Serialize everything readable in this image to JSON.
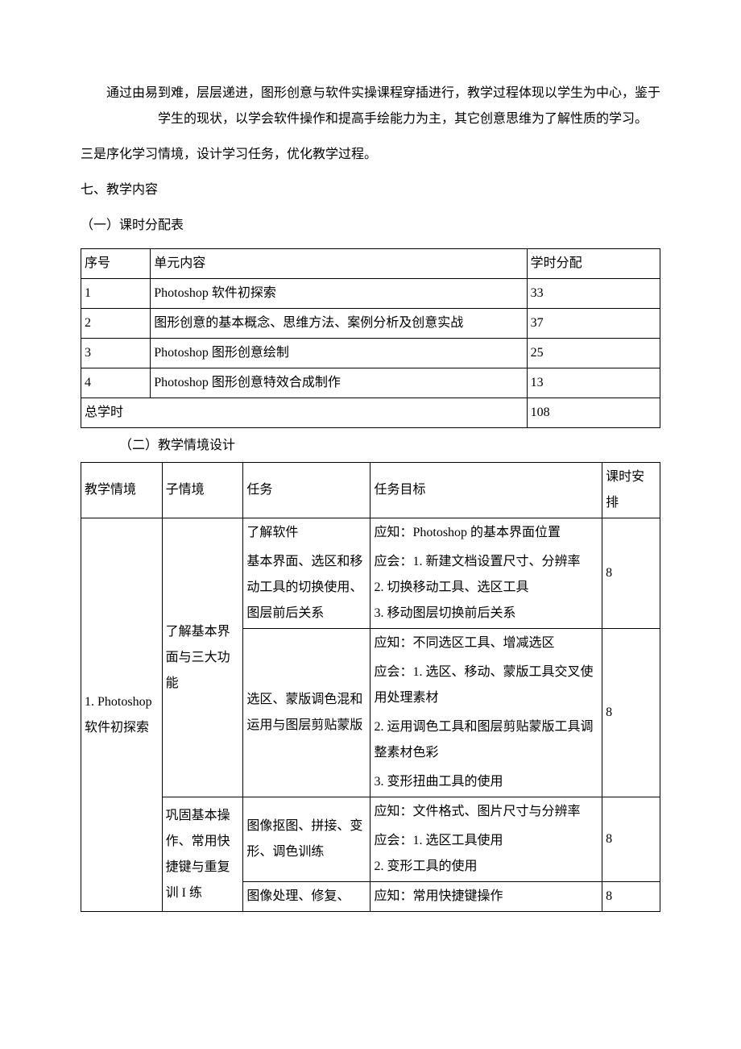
{
  "intro": {
    "p1": "通过由易到难，层层递进，图形创意与软件实操课程穿插进行，教学过程体现以学生为中心，鉴于学生的现状，以学会软件操作和提高手绘能力为主，其它创意思维为了解性质的学习。",
    "p2": "三是序化学习情境，设计学习任务，优化教学过程。"
  },
  "section7": {
    "title": "七、教学内容",
    "sub1": {
      "title": "（一）课时分配表",
      "headers": {
        "seq": "序号",
        "content": "单元内容",
        "hours": "学时分配"
      },
      "rows": [
        {
          "seq": "1",
          "content": "Photoshop 软件初探索",
          "hours": "33"
        },
        {
          "seq": "2",
          "content": "图形创意的基本概念、思维方法、案例分析及创意实战",
          "hours": "37"
        },
        {
          "seq": "3",
          "content": "Photoshop 图形创意绘制",
          "hours": "25"
        },
        {
          "seq": "4",
          "content": "Photoshop 图形创意特效合成制作",
          "hours": "13"
        }
      ],
      "total": {
        "label": "总学时",
        "hours": "108"
      }
    },
    "sub2": {
      "title": "（二）教学情境设计",
      "headers": {
        "c1": "教学情境",
        "c2": "子情境",
        "c3": "任务",
        "c4": "任务目标",
        "c5": "课时安排"
      },
      "context1": {
        "name": "1. Photoshop 软件初探索",
        "subA": {
          "name": "了解基本界面与三大功能",
          "task1": {
            "taskTitle": "了解软件",
            "taskBody": "基本界面、选区和移动工具的切换使用、图层前后关系",
            "goal_know": "应知：Photoshop 的基本界面位置",
            "goal_do_intro": "应会：1. 新建文档设置尺寸、分辨率",
            "goal_do_2": "2. 切换移动工具、选区工具",
            "goal_do_3": "3. 移动图层切换前后关系",
            "hours": "8"
          },
          "task2": {
            "task": "选区、蒙版调色混和运用与图层剪贴蒙版",
            "goal_know": "应知：不同选区工具、增减选区",
            "goal_do_1": "应会：1. 选区、移动、蒙版工具交叉使用处理素材",
            "goal_do_2": "2. 运用调色工具和图层剪贴蒙版工具调整素材色彩",
            "goal_do_3": "3. 变形扭曲工具的使用",
            "hours": "8"
          }
        },
        "subB": {
          "name": "巩固基本操作、常用快捷键与重复训 I 练",
          "task1": {
            "task": "图像抠图、拼接、变形、调色训练",
            "goal_know": "应知：文件格式、图片尺寸与分辨率",
            "goal_do_1": "应会：1. 选区工具使用",
            "goal_do_2": "2. 变形工具的使用",
            "hours": "8"
          },
          "task2": {
            "task": "图像处理、修复、",
            "goal_know": "应知：常用快捷键操作",
            "hours": "8"
          }
        }
      }
    }
  }
}
